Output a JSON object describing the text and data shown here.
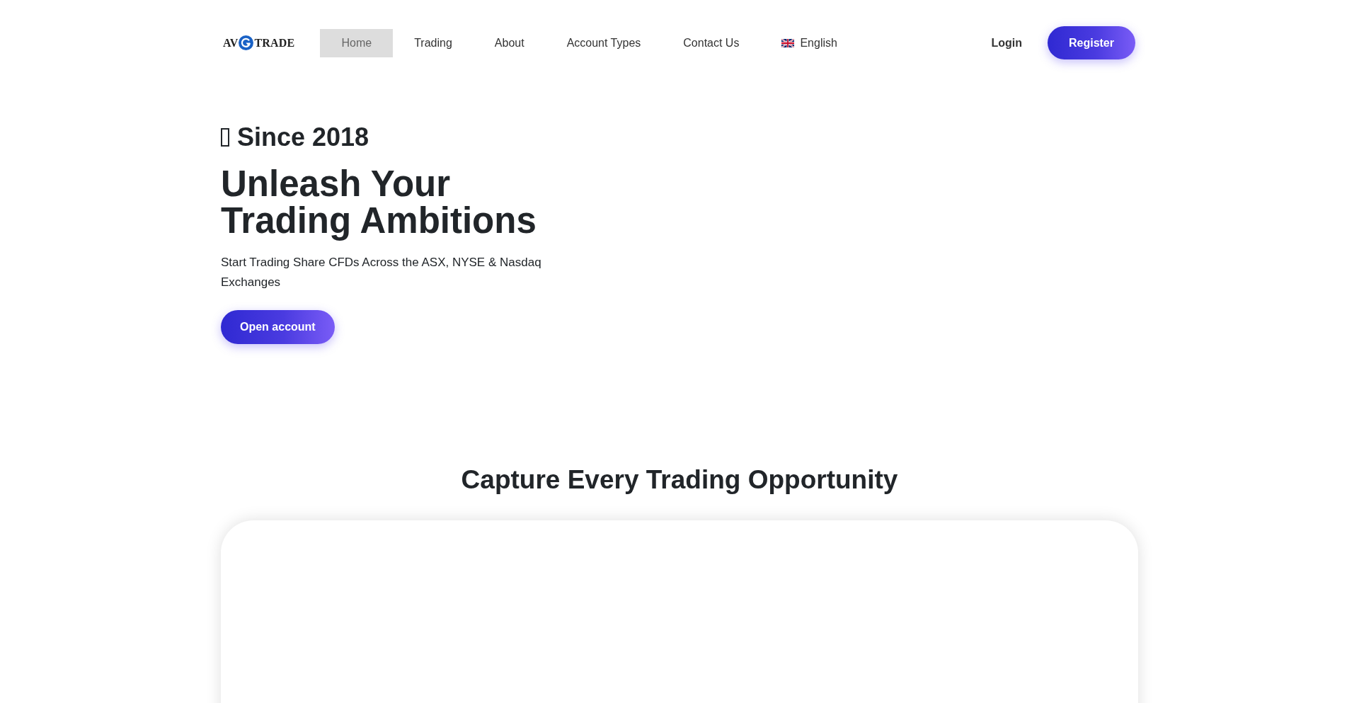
{
  "header": {
    "logo": {
      "left_text": "AV",
      "right_text": "TRADE"
    },
    "nav": [
      {
        "label": "Home",
        "selected": true
      },
      {
        "label": "Trading",
        "selected": false
      },
      {
        "label": "About",
        "selected": false
      },
      {
        "label": "Account Types",
        "selected": false
      },
      {
        "label": "Contact Us",
        "selected": false
      }
    ],
    "language": {
      "label": "English"
    },
    "login": "Login",
    "register": "Register"
  },
  "hero": {
    "eyebrow": "Since 2018",
    "title": "Unleash Your Trading Ambitions",
    "subtitle": "Start Trading Share CFDs Across the ASX, NYSE & Nasdaq Exchanges",
    "cta": "Open account"
  },
  "features": {
    "title": "Capture Every Trading Opportunity"
  }
}
